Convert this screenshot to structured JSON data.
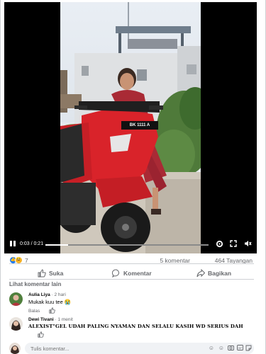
{
  "video": {
    "time_current": "0:03",
    "time_total": "0:21",
    "time_label": "0:03 / 0:21",
    "progress_fraction": 0.14,
    "plate_text": "BK 1111 A"
  },
  "stats": {
    "reaction_count": "7",
    "comment_count": "5 komentar",
    "view_count": "464 Tayangan"
  },
  "actions": {
    "like": "Suka",
    "comment": "Komentar",
    "share": "Bagikan"
  },
  "see_more_comments": "Lihat komentar lain",
  "comments": [
    {
      "name": "Aulia Liya",
      "time": "· 2 hari",
      "text": "Mukak kuu tee 😭",
      "reply": "Balas"
    },
    {
      "name": "Dewi Tivani",
      "time": "· 1 menit",
      "text": "ALEXIST\"GEL UDAH PALING NYAMAN DAN SELALU KASIH WD SERIUS DAH"
    }
  ],
  "write_comment": {
    "placeholder": "Tulis komentar..."
  },
  "colors": {
    "like_blue": "#1877f2",
    "haha_yellow": "#f7b125",
    "scooter_red": "#d9232a",
    "text_secondary": "#65676b"
  }
}
